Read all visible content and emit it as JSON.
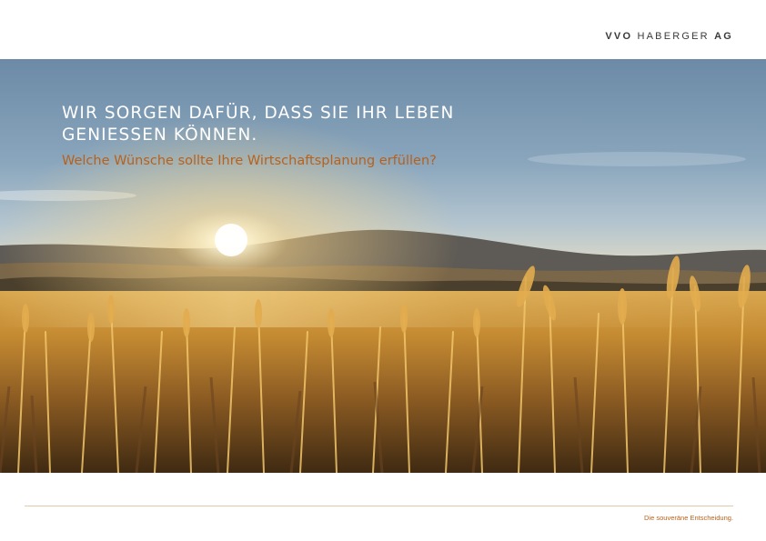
{
  "brand": {
    "logo_bold_1": "VVO",
    "logo_light": "HABERGER",
    "logo_bold_2": "AG"
  },
  "hero": {
    "headline_line1": "WIR SORGEN DAFÜR, DASS SIE IHR LEBEN",
    "headline_line2": "GENIESSEN KÖNNEN.",
    "subline": "Welche Wünsche sollte Ihre Wirtschaftsplanung erfüllen?"
  },
  "footer": {
    "slogan": "Die souveräne Entscheidung."
  },
  "colors": {
    "accent": "#b8611c",
    "divider": "#e3c9a8",
    "logo_text": "#3a3a3a"
  }
}
